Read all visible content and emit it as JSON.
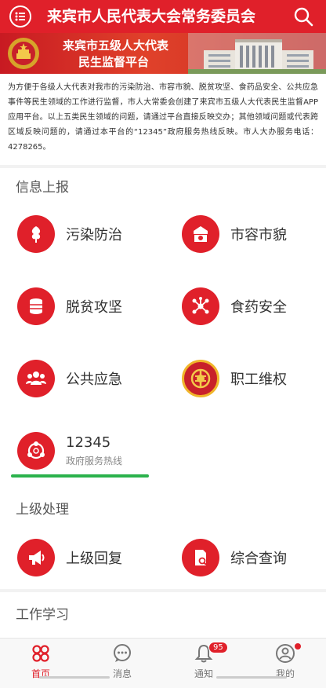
{
  "header": {
    "title": "来宾市人民代表大会常务委员会"
  },
  "banner": {
    "line1": "来宾市五级人大代表",
    "line2": "民生监督平台"
  },
  "notice": {
    "text": "为方便于各级人大代表对我市的污染防治、市容市貌、脱贫攻坚、食药品安全、公共应急事件等民生领域的工作进行监督，市人大常委会创建了来宾市五级人大代表民生监督APP应用平台。以上五类民生领域的问题，请通过平台直接反映交办；其他领域问题或代表跨区域反映问题的，请通过本平台的“12345”政府服务热线反映。市人大办服务电话：4278265。"
  },
  "sections": {
    "report": {
      "title": "信息上报",
      "items": [
        {
          "label": "污染防治",
          "icon": "leaf-icon"
        },
        {
          "label": "市容市貌",
          "icon": "city-icon"
        },
        {
          "label": "脱贫攻坚",
          "icon": "coins-icon"
        },
        {
          "label": "食药安全",
          "icon": "molecule-icon"
        },
        {
          "label": "公共应急",
          "icon": "people-icon"
        },
        {
          "label": "职工维权",
          "icon": "union-emblem-icon"
        },
        {
          "label": "12345",
          "sub": "政府服务热线",
          "icon": "hotline-icon"
        }
      ]
    },
    "upper": {
      "title": "上级处理",
      "items": [
        {
          "label": "上级回复",
          "icon": "megaphone-icon"
        },
        {
          "label": "综合查询",
          "icon": "document-search-icon"
        }
      ]
    },
    "study": {
      "title": "工作学习"
    }
  },
  "tabbar": {
    "tabs": [
      {
        "label": "首页",
        "icon": "home-grid-icon",
        "active": true
      },
      {
        "label": "消息",
        "icon": "message-icon"
      },
      {
        "label": "通知",
        "icon": "bell-icon",
        "badge": "95"
      },
      {
        "label": "我的",
        "icon": "user-icon",
        "dot": true
      }
    ]
  },
  "colors": {
    "brand_red": "#e0202a",
    "underline_green": "#2bb24c"
  }
}
